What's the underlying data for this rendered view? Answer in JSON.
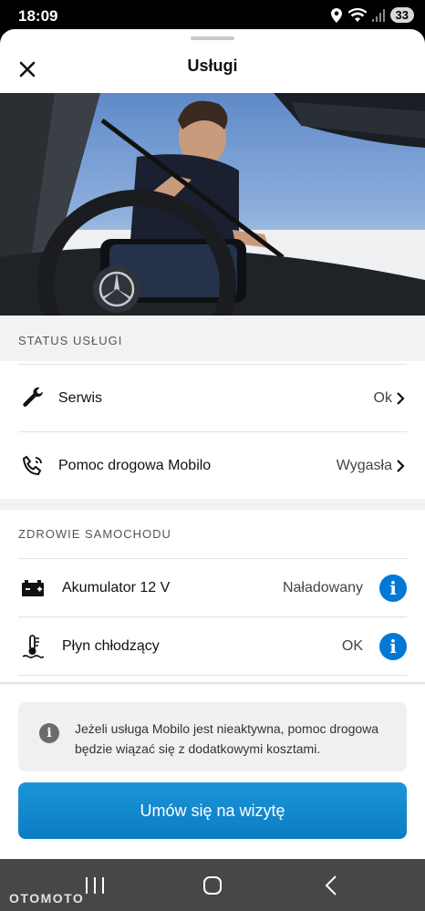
{
  "status_bar": {
    "time": "18:09",
    "battery": "33"
  },
  "header": {
    "title": "Usługi"
  },
  "service_status": {
    "heading": "STATUS USŁUGI",
    "rows": [
      {
        "label": "Serwis",
        "value": "Ok",
        "icon": "wrench-icon"
      },
      {
        "label": "Pomoc drogowa Mobilo",
        "value": "Wygasła",
        "icon": "roadside-phone-icon"
      }
    ]
  },
  "car_health": {
    "heading": "ZDROWIE SAMOCHODU",
    "rows": [
      {
        "label": "Akumulator 12 V",
        "value": "Naładowany",
        "icon": "battery-icon"
      },
      {
        "label": "Płyn chłodzący",
        "value": "OK",
        "icon": "coolant-icon"
      }
    ]
  },
  "notice": {
    "text": "Jeżeli usługa Mobilo jest nieaktywna, pomoc drogowa będzie wiązać się z dodatkowymi kosztami."
  },
  "cta": {
    "label": "Umów się na wizytę"
  },
  "watermark": "OTOMOTO",
  "colors": {
    "accent": "#0078d6",
    "button": "#0b7cc3"
  }
}
